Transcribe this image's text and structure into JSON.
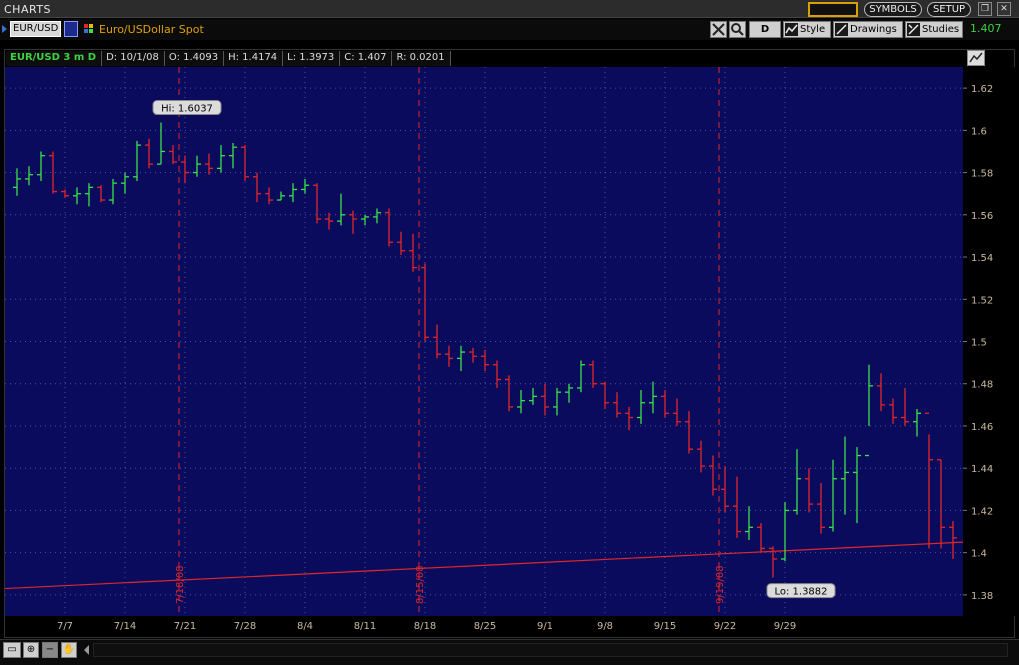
{
  "window": {
    "title": "CHARTS",
    "symbols_label": "SYMBOLS",
    "setup_label": "SETUP",
    "colors": {
      "background": "#000000",
      "plot_background": "#0b0b5e",
      "up_bar": "#39e14a",
      "down_bar": "#e02727",
      "grid": "#4a4fb0",
      "axis_text": "#c8b9a0",
      "accent": "#d8a000"
    }
  },
  "toolbar": {
    "symbol": "EUR/USD",
    "description": "Euro/USDollar Spot",
    "period_button": "D",
    "style_label": "Style",
    "drawings_label": "Drawings",
    "studies_label": "Studies",
    "last_price": "1.407"
  },
  "infobar": {
    "symbol": "EUR/USD 3 m D",
    "date": "D: 10/1/08",
    "open": "O: 1.4093",
    "high": "H: 1.4174",
    "low": "L: 1.3973",
    "close": "C: 1.407",
    "range": "R: 0.0201"
  },
  "chart_data": {
    "type": "ohlc",
    "title": "EUR/USD 3 m D",
    "ylim": [
      1.37,
      1.63
    ],
    "y_ticks": [
      "1.62",
      "1.6",
      "1.58",
      "1.56",
      "1.54",
      "1.52",
      "1.5",
      "1.48",
      "1.46",
      "1.44",
      "1.42",
      "1.4",
      "1.38"
    ],
    "x_ticks": [
      "7/7",
      "7/14",
      "7/21",
      "7/28",
      "8/4",
      "8/11",
      "8/18",
      "8/25",
      "9/1",
      "9/8",
      "9/15",
      "9/22",
      "9/29"
    ],
    "grid": true,
    "bars": [
      {
        "date": "7/1",
        "o": 1.573,
        "h": 1.582,
        "l": 1.569,
        "c": 1.577
      },
      {
        "date": "7/2",
        "o": 1.577,
        "h": 1.583,
        "l": 1.574,
        "c": 1.579
      },
      {
        "date": "7/3",
        "o": 1.579,
        "h": 1.59,
        "l": 1.576,
        "c": 1.588
      },
      {
        "date": "7/4",
        "o": 1.588,
        "h": 1.59,
        "l": 1.57,
        "c": 1.571
      },
      {
        "date": "7/7",
        "o": 1.571,
        "h": 1.572,
        "l": 1.568,
        "c": 1.569
      },
      {
        "date": "7/8",
        "o": 1.569,
        "h": 1.573,
        "l": 1.565,
        "c": 1.57
      },
      {
        "date": "7/9",
        "o": 1.57,
        "h": 1.575,
        "l": 1.564,
        "c": 1.573
      },
      {
        "date": "7/10",
        "o": 1.573,
        "h": 1.574,
        "l": 1.566,
        "c": 1.567
      },
      {
        "date": "7/11",
        "o": 1.567,
        "h": 1.577,
        "l": 1.565,
        "c": 1.575
      },
      {
        "date": "7/14",
        "o": 1.575,
        "h": 1.58,
        "l": 1.57,
        "c": 1.578
      },
      {
        "date": "7/15",
        "o": 1.578,
        "h": 1.595,
        "l": 1.576,
        "c": 1.593
      },
      {
        "date": "7/16",
        "o": 1.593,
        "h": 1.596,
        "l": 1.582,
        "c": 1.584
      },
      {
        "date": "7/17",
        "o": 1.584,
        "h": 1.6037,
        "l": 1.584,
        "c": 1.59
      },
      {
        "date": "7/18",
        "o": 1.59,
        "h": 1.593,
        "l": 1.584,
        "c": 1.585
      },
      {
        "date": "7/21",
        "o": 1.585,
        "h": 1.588,
        "l": 1.575,
        "c": 1.58
      },
      {
        "date": "7/22",
        "o": 1.58,
        "h": 1.588,
        "l": 1.578,
        "c": 1.584
      },
      {
        "date": "7/23",
        "o": 1.584,
        "h": 1.589,
        "l": 1.579,
        "c": 1.582
      },
      {
        "date": "7/24",
        "o": 1.582,
        "h": 1.593,
        "l": 1.58,
        "c": 1.588
      },
      {
        "date": "7/25",
        "o": 1.588,
        "h": 1.594,
        "l": 1.582,
        "c": 1.592
      },
      {
        "date": "7/28",
        "o": 1.592,
        "h": 1.593,
        "l": 1.576,
        "c": 1.578
      },
      {
        "date": "7/29",
        "o": 1.578,
        "h": 1.58,
        "l": 1.566,
        "c": 1.57
      },
      {
        "date": "7/30",
        "o": 1.57,
        "h": 1.573,
        "l": 1.565,
        "c": 1.567
      },
      {
        "date": "7/31",
        "o": 1.567,
        "h": 1.571,
        "l": 1.567,
        "c": 1.569
      },
      {
        "date": "8/1",
        "o": 1.569,
        "h": 1.575,
        "l": 1.566,
        "c": 1.572
      },
      {
        "date": "8/4",
        "o": 1.572,
        "h": 1.577,
        "l": 1.57,
        "c": 1.574
      },
      {
        "date": "8/5",
        "o": 1.574,
        "h": 1.575,
        "l": 1.556,
        "c": 1.558
      },
      {
        "date": "8/6",
        "o": 1.558,
        "h": 1.561,
        "l": 1.553,
        "c": 1.557
      },
      {
        "date": "8/7",
        "o": 1.557,
        "h": 1.57,
        "l": 1.555,
        "c": 1.56
      },
      {
        "date": "8/8",
        "o": 1.56,
        "h": 1.562,
        "l": 1.551,
        "c": 1.558
      },
      {
        "date": "8/11",
        "o": 1.558,
        "h": 1.56,
        "l": 1.555,
        "c": 1.559
      },
      {
        "date": "8/12",
        "o": 1.559,
        "h": 1.563,
        "l": 1.556,
        "c": 1.561
      },
      {
        "date": "8/13",
        "o": 1.561,
        "h": 1.563,
        "l": 1.545,
        "c": 1.547
      },
      {
        "date": "8/14",
        "o": 1.547,
        "h": 1.552,
        "l": 1.541,
        "c": 1.543
      },
      {
        "date": "8/15",
        "o": 1.543,
        "h": 1.551,
        "l": 1.533,
        "c": 1.535
      },
      {
        "date": "8/18",
        "o": 1.535,
        "h": 1.537,
        "l": 1.5,
        "c": 1.502
      },
      {
        "date": "8/19",
        "o": 1.502,
        "h": 1.508,
        "l": 1.492,
        "c": 1.494
      },
      {
        "date": "8/20",
        "o": 1.494,
        "h": 1.498,
        "l": 1.488,
        "c": 1.492
      },
      {
        "date": "8/21",
        "o": 1.492,
        "h": 1.498,
        "l": 1.486,
        "c": 1.495
      },
      {
        "date": "8/22",
        "o": 1.495,
        "h": 1.497,
        "l": 1.49,
        "c": 1.493
      },
      {
        "date": "8/25",
        "o": 1.493,
        "h": 1.496,
        "l": 1.486,
        "c": 1.489
      },
      {
        "date": "8/26",
        "o": 1.489,
        "h": 1.491,
        "l": 1.478,
        "c": 1.482
      },
      {
        "date": "8/27",
        "o": 1.482,
        "h": 1.484,
        "l": 1.467,
        "c": 1.469
      },
      {
        "date": "8/28",
        "o": 1.469,
        "h": 1.477,
        "l": 1.466,
        "c": 1.472
      },
      {
        "date": "8/29",
        "o": 1.472,
        "h": 1.478,
        "l": 1.47,
        "c": 1.474
      },
      {
        "date": "9/1",
        "o": 1.474,
        "h": 1.48,
        "l": 1.465,
        "c": 1.469
      },
      {
        "date": "9/2",
        "o": 1.469,
        "h": 1.478,
        "l": 1.465,
        "c": 1.476
      },
      {
        "date": "9/3",
        "o": 1.476,
        "h": 1.48,
        "l": 1.471,
        "c": 1.478
      },
      {
        "date": "9/4",
        "o": 1.478,
        "h": 1.491,
        "l": 1.476,
        "c": 1.489
      },
      {
        "date": "9/5",
        "o": 1.489,
        "h": 1.491,
        "l": 1.478,
        "c": 1.48
      },
      {
        "date": "9/8",
        "o": 1.48,
        "h": 1.481,
        "l": 1.468,
        "c": 1.471
      },
      {
        "date": "9/9",
        "o": 1.471,
        "h": 1.476,
        "l": 1.464,
        "c": 1.466
      },
      {
        "date": "9/10",
        "o": 1.466,
        "h": 1.469,
        "l": 1.458,
        "c": 1.464
      },
      {
        "date": "9/11",
        "o": 1.464,
        "h": 1.477,
        "l": 1.461,
        "c": 1.471
      },
      {
        "date": "9/12",
        "o": 1.471,
        "h": 1.481,
        "l": 1.466,
        "c": 1.474
      },
      {
        "date": "9/15",
        "o": 1.474,
        "h": 1.477,
        "l": 1.464,
        "c": 1.466
      },
      {
        "date": "9/16",
        "o": 1.466,
        "h": 1.473,
        "l": 1.46,
        "c": 1.462
      },
      {
        "date": "9/17",
        "o": 1.462,
        "h": 1.467,
        "l": 1.447,
        "c": 1.449
      },
      {
        "date": "9/18",
        "o": 1.449,
        "h": 1.453,
        "l": 1.438,
        "c": 1.441
      },
      {
        "date": "9/19",
        "o": 1.441,
        "h": 1.446,
        "l": 1.427,
        "c": 1.43
      },
      {
        "date": "9/22",
        "o": 1.43,
        "h": 1.441,
        "l": 1.419,
        "c": 1.422
      },
      {
        "date": "9/23",
        "o": 1.422,
        "h": 1.436,
        "l": 1.407,
        "c": 1.41
      },
      {
        "date": "9/24",
        "o": 1.41,
        "h": 1.422,
        "l": 1.406,
        "c": 1.412
      },
      {
        "date": "9/25",
        "o": 1.412,
        "h": 1.414,
        "l": 1.4,
        "c": 1.402
      },
      {
        "date": "9/26",
        "o": 1.402,
        "h": 1.403,
        "l": 1.3882,
        "c": 1.397
      },
      {
        "date": "9/29",
        "o": 1.397,
        "h": 1.424,
        "l": 1.396,
        "c": 1.42
      },
      {
        "date": "9/30",
        "o": 1.42,
        "h": 1.449,
        "l": 1.418,
        "c": 1.435
      },
      {
        "date": "10/1",
        "o": 1.435,
        "h": 1.44,
        "l": 1.419,
        "c": 1.423
      },
      {
        "date": "10/2",
        "o": 1.423,
        "h": 1.433,
        "l": 1.409,
        "c": 1.412
      },
      {
        "date": "10/3",
        "o": 1.412,
        "h": 1.444,
        "l": 1.41,
        "c": 1.435
      },
      {
        "date": "10/6",
        "o": 1.435,
        "h": 1.455,
        "l": 1.418,
        "c": 1.438
      },
      {
        "date": "10/7",
        "o": 1.438,
        "h": 1.45,
        "l": 1.414,
        "c": 1.446
      },
      {
        "date": "10/8",
        "o": 1.446,
        "h": 1.489,
        "l": 1.46,
        "c": 1.479
      },
      {
        "date": "10/9",
        "o": 1.479,
        "h": 1.485,
        "l": 1.467,
        "c": 1.47
      },
      {
        "date": "10/10",
        "o": 1.47,
        "h": 1.473,
        "l": 1.461,
        "c": 1.464
      },
      {
        "date": "10/13",
        "o": 1.464,
        "h": 1.478,
        "l": 1.46,
        "c": 1.462
      },
      {
        "date": "10/14",
        "o": 1.462,
        "h": 1.468,
        "l": 1.455,
        "c": 1.466
      },
      {
        "date": "10/15",
        "o": 1.466,
        "h": 1.456,
        "l": 1.402,
        "c": 1.444
      },
      {
        "date": "10/16",
        "o": 1.444,
        "h": 1.444,
        "l": 1.402,
        "c": 1.412
      },
      {
        "date": "10/17",
        "o": 1.412,
        "h": 1.415,
        "l": 1.397,
        "c": 1.407
      }
    ],
    "hi_label": "Hi: 1.6037",
    "lo_label": "Lo: 1.3882",
    "vertical_markers": [
      "7/18/08",
      "8/15/08",
      "9/19/08"
    ],
    "trendline": {
      "start": [
        0,
        1.383
      ],
      "end": [
        1,
        1.405
      ]
    }
  }
}
